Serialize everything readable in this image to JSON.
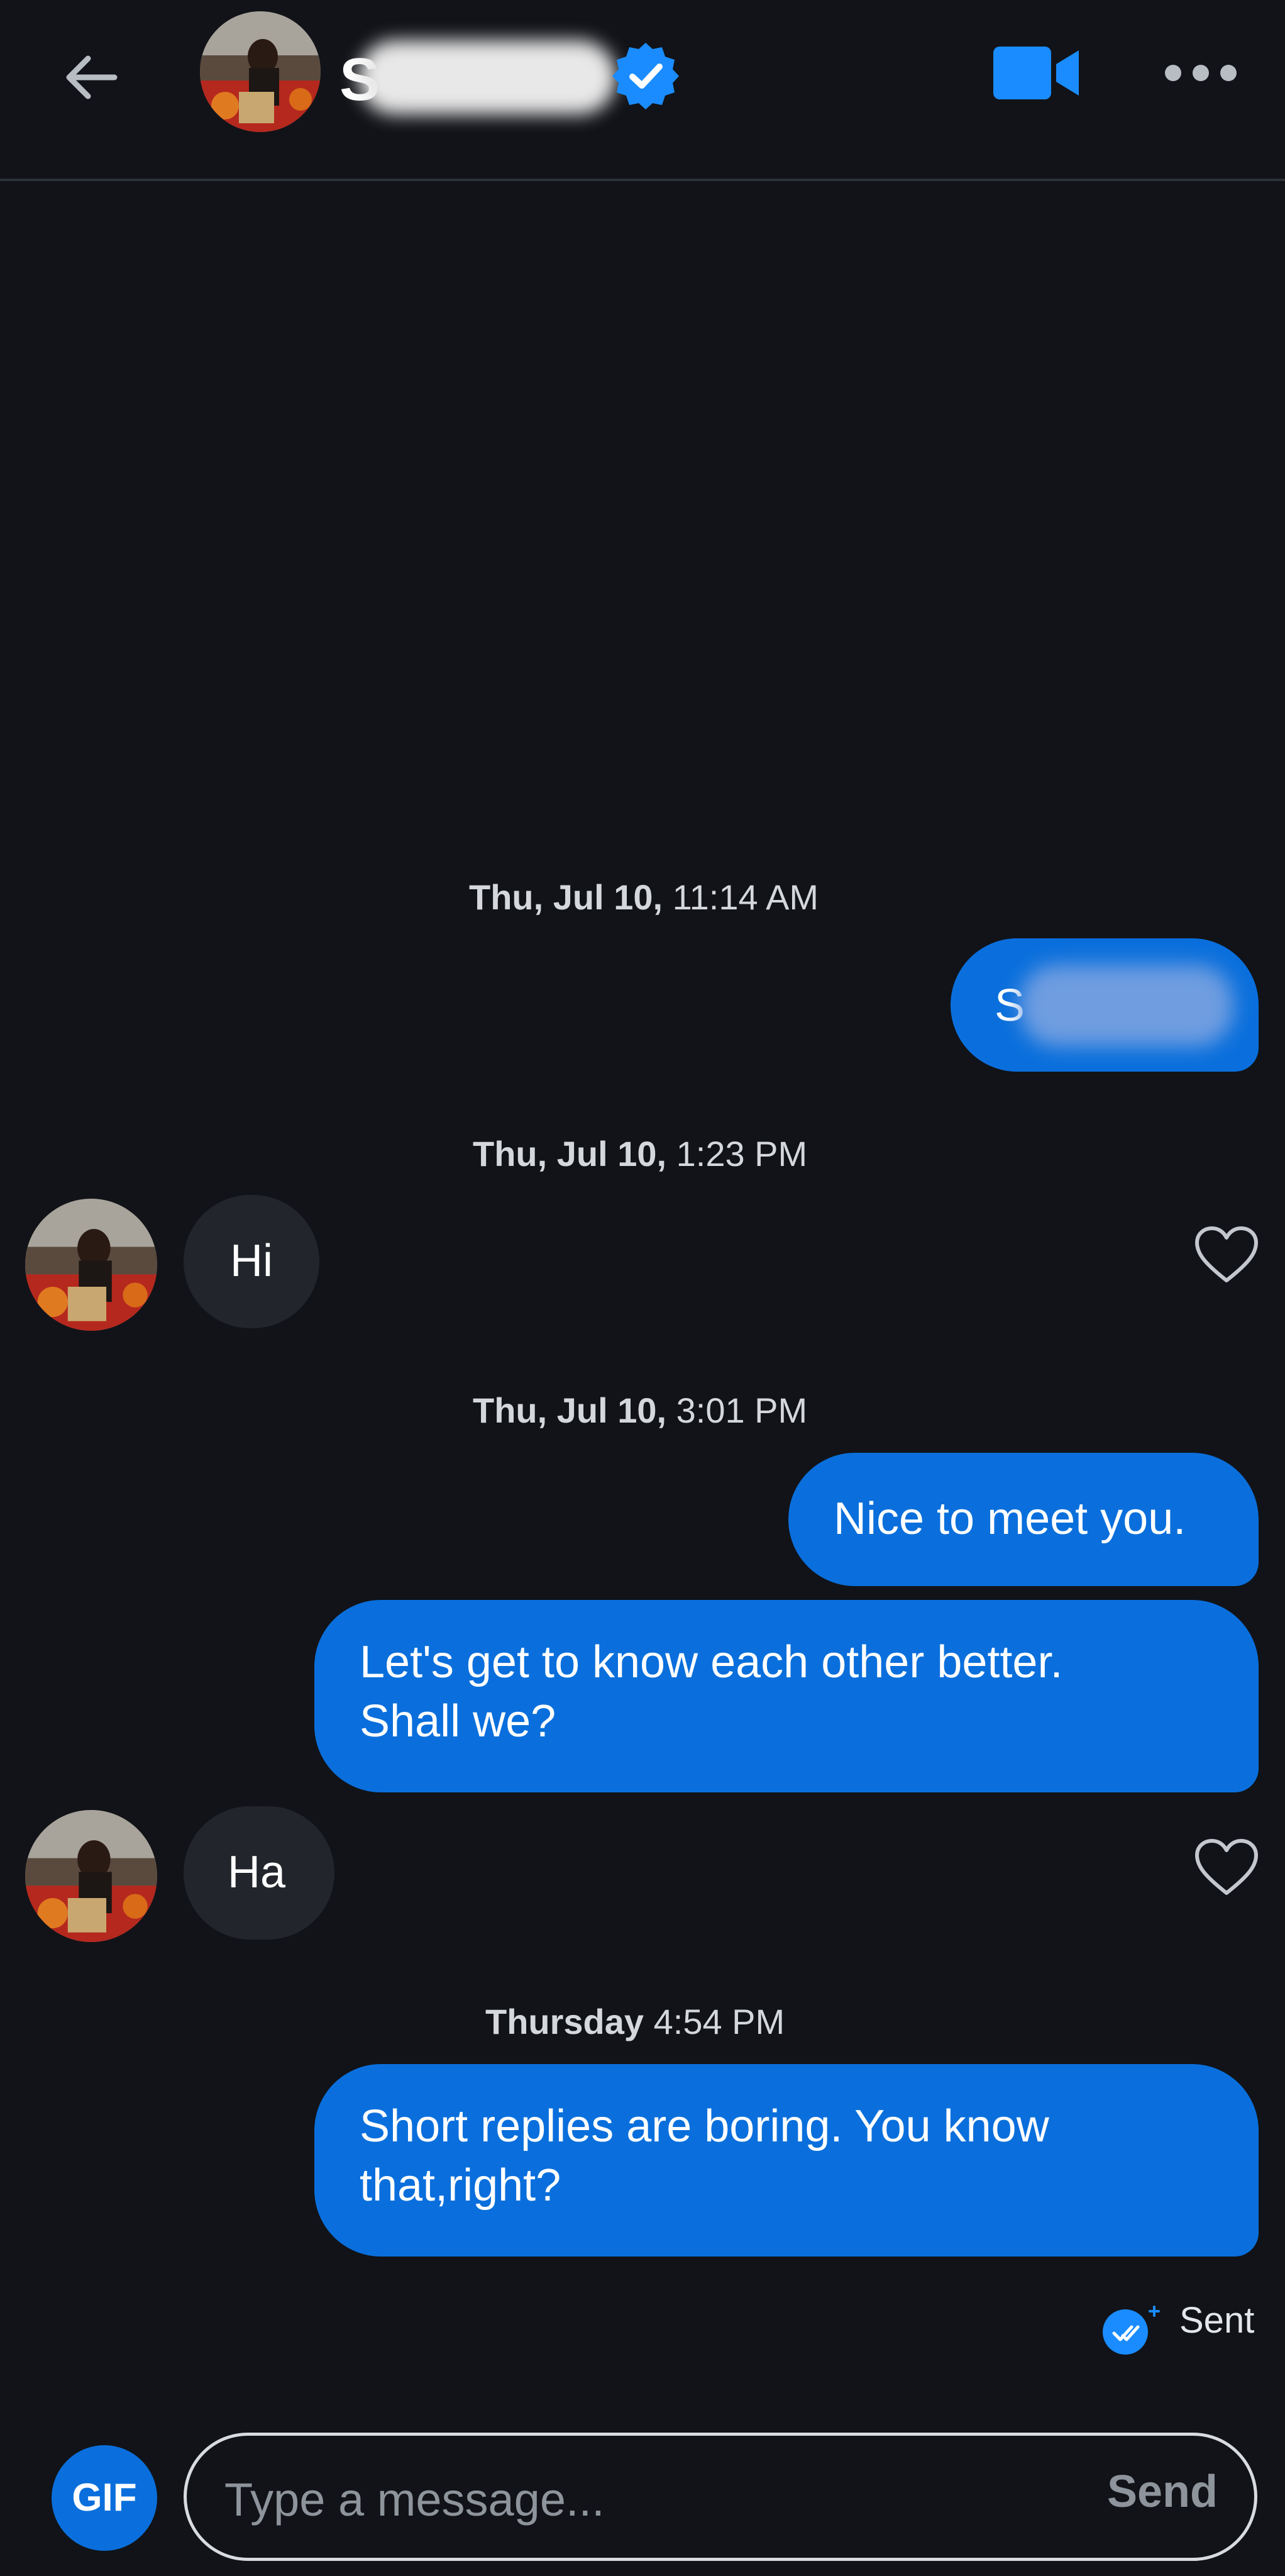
{
  "header": {
    "name_visible": "S",
    "verified_icon": "verified-badge-icon",
    "video_icon": "video-camera-icon",
    "more_icon": "more-dots-icon",
    "back_icon": "back-arrow-icon"
  },
  "messages": {
    "ts1_date": "Thu, Jul 10,",
    "ts1_time": " 11:14 AM",
    "msg1_visible": "S",
    "ts2_date": "Thu, Jul 10,",
    "ts2_time": " 1:23 PM",
    "msg2": "Hi",
    "ts3_date": "Thu, Jul 10,",
    "ts3_time": " 3:01 PM",
    "msg3": "Nice to meet you.",
    "msg4_line1": "Let's get to know each other better.",
    "msg4_line2": "Shall we?",
    "msg5": "Ha",
    "ts4_date": "Thursday",
    "ts4_time": " 4:54 PM",
    "msg6_line1": "Short replies are boring. You know",
    "msg6_line2": "that,right?"
  },
  "status": {
    "sent_label": "Sent"
  },
  "composer": {
    "gif_label": "GIF",
    "placeholder": "Type a message...",
    "send_label": "Send"
  },
  "colors": {
    "background": "#111318",
    "outgoing_bubble": "#0a6fdc",
    "incoming_bubble": "#22262c",
    "accent": "#1a8cff"
  }
}
